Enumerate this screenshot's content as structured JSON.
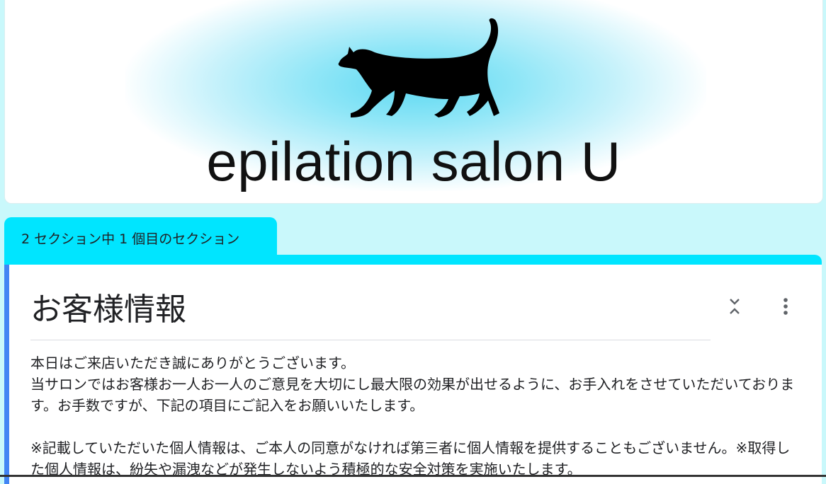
{
  "header": {
    "brand_name": "epilation salon U",
    "logo_icon": "cat-silhouette-icon"
  },
  "section_indicator": "2 セクション中 1 個目のセクション",
  "section": {
    "title": "お客様情報",
    "description": "本日はご来店いただき誠にありがとうございます。\n当サロンではお客様お一人お一人のご意見を大切にし最大限の効果が出せるように、お手入れをさせていただいております。お手数ですが、下記の項目にご記入をお願いいたします。\n\n※記載していただいた個人情報は、ご本人の同意がなければ第三者に個人情報を提供することもございません。※取得した個人情報は、紛失や漏洩などが発生しないよう積極的な安全対策を実施いたします。",
    "collapse_icon": "collapse-chevrons-icon",
    "more_icon": "more-vert-icon"
  },
  "colors": {
    "page_bg": "#c9f8fb",
    "accent": "#00e5ff",
    "section_edge": "#4285f4"
  }
}
